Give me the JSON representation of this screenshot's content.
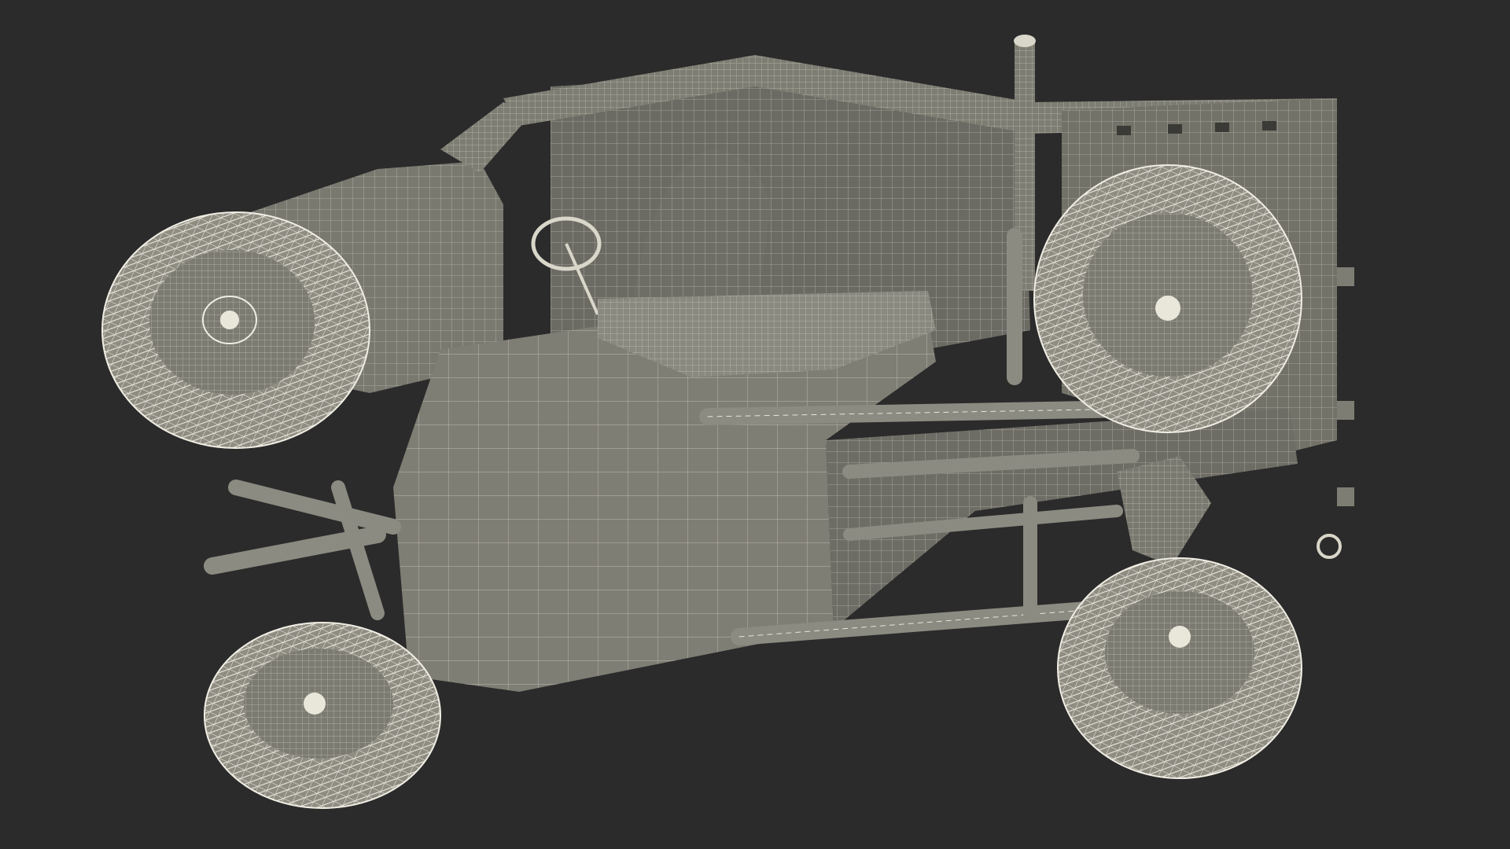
{
  "scene": {
    "background_color": "#2b2b2b",
    "model_fill_color": "#7e7d73",
    "model_dark_color": "#5f5e56",
    "wire_color": "#e9e6da",
    "tire_color": "#8a887d"
  }
}
